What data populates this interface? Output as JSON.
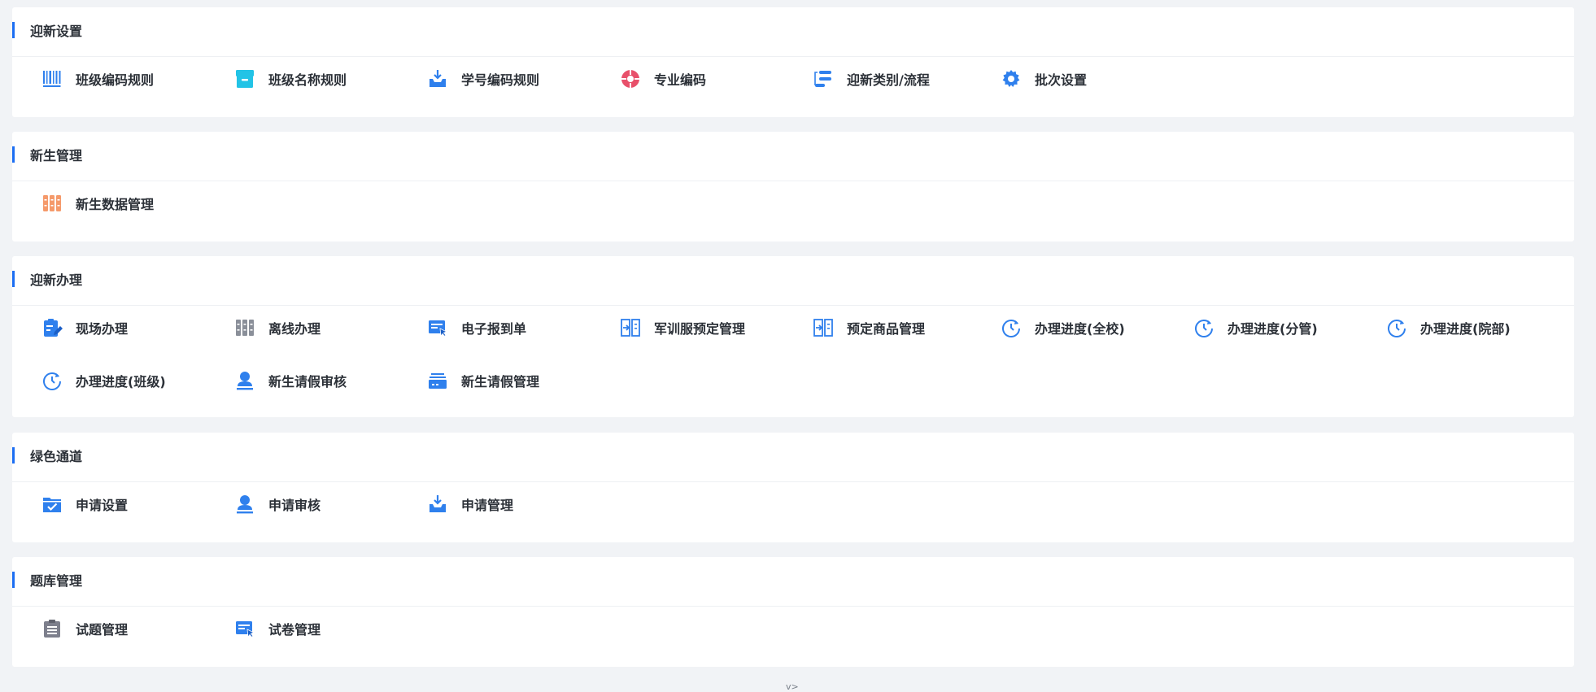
{
  "sections": [
    {
      "title": "迎新设置",
      "items": [
        {
          "label": "班级编码规则",
          "icon": "barcode-icon"
        },
        {
          "label": "班级名称规则",
          "icon": "archive-box-icon"
        },
        {
          "label": "学号编码规则",
          "icon": "inbox-download-icon"
        },
        {
          "label": "专业编码",
          "icon": "target-icon"
        },
        {
          "label": "迎新类别/流程",
          "icon": "flow-steps-icon"
        },
        {
          "label": "批次设置",
          "icon": "gear-icon"
        }
      ]
    },
    {
      "title": "新生管理",
      "items": [
        {
          "label": "新生数据管理",
          "icon": "data-grid-icon"
        }
      ]
    },
    {
      "title": "迎新办理",
      "items": [
        {
          "label": "现场办理",
          "icon": "clipboard-edit-icon"
        },
        {
          "label": "离线办理",
          "icon": "offline-grid-icon"
        },
        {
          "label": "电子报到单",
          "icon": "card-cursor-icon"
        },
        {
          "label": "军训服预定管理",
          "icon": "login-panel-icon"
        },
        {
          "label": "预定商品管理",
          "icon": "login-panel-icon"
        },
        {
          "label": "办理进度(全校)",
          "icon": "progress-cycle-icon"
        },
        {
          "label": "办理进度(分管)",
          "icon": "progress-cycle-icon"
        },
        {
          "label": "办理进度(院部)",
          "icon": "progress-cycle-icon"
        },
        {
          "label": "办理进度(班级)",
          "icon": "progress-cycle-icon"
        },
        {
          "label": "新生请假审核",
          "icon": "stamp-icon"
        },
        {
          "label": "新生请假管理",
          "icon": "tray-icon"
        }
      ]
    },
    {
      "title": "绿色通道",
      "items": [
        {
          "label": "申请设置",
          "icon": "folder-check-icon"
        },
        {
          "label": "申请审核",
          "icon": "stamp-icon"
        },
        {
          "label": "申请管理",
          "icon": "inbox-download-icon"
        }
      ]
    },
    {
      "title": "题库管理",
      "items": [
        {
          "label": "试题管理",
          "icon": "clipboard-list-icon"
        },
        {
          "label": "试卷管理",
          "icon": "card-cursor-icon"
        }
      ]
    }
  ],
  "footer": {
    "chevron": "v>"
  },
  "colors": {
    "accent": "#1c6ef3",
    "icon_blue": "#2f80ed",
    "icon_cyan": "#22c3e6",
    "icon_red": "#e8506a",
    "icon_orange": "#f59a6b",
    "icon_gray": "#8a8f99",
    "background": "#f1f3f6"
  }
}
